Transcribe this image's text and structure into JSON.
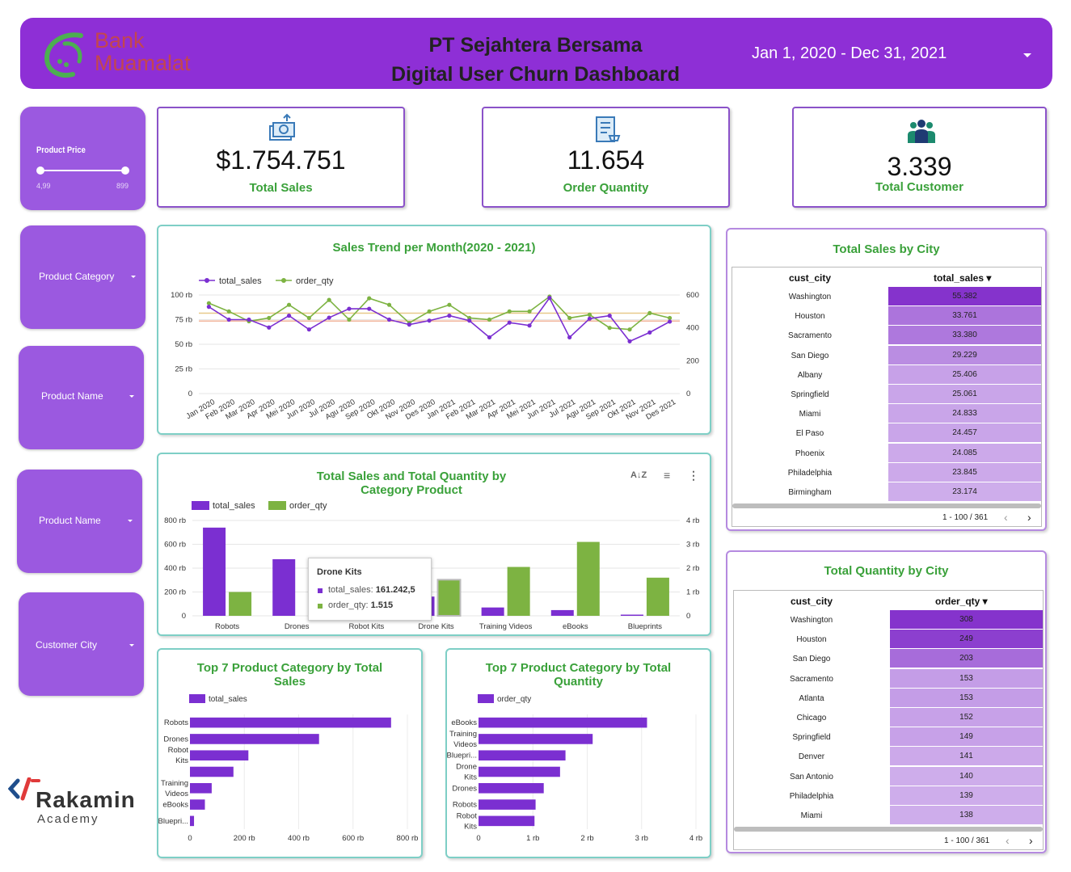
{
  "header": {
    "logo_line1": "Bank",
    "logo_line2": "Muamalat",
    "title_line1": "PT Sejahtera Bersama",
    "title_line2": "Digital User Churn Dashboard",
    "date_range": "Jan 1, 2020 - Dec 31, 2021"
  },
  "filters": {
    "price": {
      "label": "Product Price",
      "min": "4,99",
      "max": "899"
    },
    "category": "Product Category",
    "name1": "Product Name",
    "name2": "Product Name",
    "city": "Customer City"
  },
  "kpis": [
    {
      "value": "$1.754.751",
      "label": "Total Sales",
      "icon": "money-transfer-icon"
    },
    {
      "value": "11.654",
      "label": "Order Quantity",
      "icon": "order-list-icon"
    },
    {
      "value": "3.339",
      "label": "Total Customer",
      "icon": "customers-group-icon"
    }
  ],
  "brand": {
    "name": "Rakamin",
    "sub": "Academy"
  },
  "colors": {
    "purple": "#7b2fd1",
    "green": "#7db342",
    "header": "#8e2fd6",
    "filter": "#9b59e0",
    "kpi_text": "#3aa13a"
  },
  "chart_data": [
    {
      "type": "line",
      "title": "Sales Trend per Month(2020 - 2021)",
      "categories": [
        "Jan 2020",
        "Feb 2020",
        "Mar 2020",
        "Apr 2020",
        "Mei 2020",
        "Jun 2020",
        "Jul 2020",
        "Agu 2020",
        "Sep 2020",
        "Okt 2020",
        "Nov 2020",
        "Des 2020",
        "Jan 2021",
        "Feb 2021",
        "Mar 2021",
        "Apr 2021",
        "Mei 2021",
        "Jun 2021",
        "Jul 2021",
        "Agu 2021",
        "Sep 2021",
        "Okt 2021",
        "Nov 2021",
        "Des 2021"
      ],
      "yticks_left": [
        "0",
        "25 rb",
        "50 rb",
        "75 rb",
        "100 rb"
      ],
      "yticks_right": [
        "0",
        "200",
        "400",
        "600"
      ],
      "ylim_left": [
        0,
        100000
      ],
      "ylim_right": [
        0,
        600
      ],
      "series": [
        {
          "name": "total_sales",
          "axis": "left",
          "color": "#7b2fd1",
          "values": [
            88000,
            75000,
            75000,
            67000,
            79000,
            65000,
            77000,
            86000,
            86000,
            75000,
            70000,
            74000,
            79000,
            74000,
            57000,
            72000,
            69000,
            97000,
            57000,
            76000,
            79000,
            53000,
            62000,
            73000
          ]
        },
        {
          "name": "order_qty",
          "axis": "right",
          "color": "#7db342",
          "values": [
            550,
            500,
            440,
            460,
            540,
            460,
            570,
            450,
            580,
            540,
            430,
            500,
            540,
            460,
            450,
            500,
            500,
            590,
            460,
            480,
            400,
            390,
            490,
            460
          ]
        }
      ]
    },
    {
      "type": "bar",
      "title": "Total Sales and Total Quantity by Category Product",
      "categories": [
        "Robots",
        "Drones",
        "Robot Kits",
        "Drone Kits",
        "Training Videos",
        "eBooks",
        "Blueprints"
      ],
      "yticks_left": [
        "0",
        "200 rb",
        "400 rb",
        "600 rb",
        "800 rb"
      ],
      "yticks_right": [
        "0",
        "1 rb",
        "2 rb",
        "3 rb",
        "4 rb"
      ],
      "ylim_left": [
        0,
        800000
      ],
      "ylim_right": [
        0,
        4000
      ],
      "series": [
        {
          "name": "total_sales",
          "axis": "left",
          "color": "#7b2fd1",
          "values": [
            740000,
            475000,
            300000,
            161242.5,
            70000,
            48000,
            10000
          ]
        },
        {
          "name": "order_qty",
          "axis": "right",
          "color": "#7db342",
          "values": [
            1000,
            0,
            0,
            1515,
            2050,
            3100,
            1600
          ]
        }
      ],
      "tooltip": {
        "title": "Drone Kits",
        "line1_label": "total_sales:",
        "line1_value": "161.242,5",
        "line2_label": "order_qty:",
        "line2_value": "1.515"
      }
    },
    {
      "type": "bar",
      "orientation": "horizontal",
      "title_line1": "Top 7 Product Category by Total",
      "title_line2": "Sales",
      "series_name": "total_sales",
      "categories": [
        [
          "Robots"
        ],
        [
          "Drones"
        ],
        [
          "Robot",
          "Kits"
        ],
        [
          ""
        ],
        [
          "Training",
          "Videos"
        ],
        [
          "eBooks"
        ],
        [
          "Bluepri..."
        ]
      ],
      "values": [
        740000,
        475000,
        215000,
        160000,
        80000,
        55000,
        15000
      ],
      "xticks": [
        "0",
        "200 rb",
        "400 rb",
        "600 rb",
        "800 rb"
      ],
      "xlim": [
        0,
        800000
      ]
    },
    {
      "type": "bar",
      "orientation": "horizontal",
      "title_line1": "Top 7 Product Category by Total",
      "title_line2": "Quantity",
      "series_name": "order_qty",
      "categories": [
        [
          "eBooks"
        ],
        [
          "Training",
          "Videos"
        ],
        [
          "Bluepri..."
        ],
        [
          "Drone",
          "Kits"
        ],
        [
          "Drones"
        ],
        [
          "Robots"
        ],
        [
          "Robot",
          "Kits"
        ]
      ],
      "values": [
        3100,
        2100,
        1600,
        1500,
        1200,
        1050,
        1030
      ],
      "xticks": [
        "0",
        "1 rb",
        "2 rb",
        "3 rb",
        "4 rb"
      ],
      "xlim": [
        0,
        4000
      ]
    },
    {
      "type": "table",
      "title": "Total Sales by City",
      "columns": [
        "cust_city",
        "total_sales"
      ],
      "rows": [
        [
          "Washington",
          "55.382"
        ],
        [
          "Houston",
          "33.761"
        ],
        [
          "Sacramento",
          "33.380"
        ],
        [
          "San Diego",
          "29.229"
        ],
        [
          "Albany",
          "25.406"
        ],
        [
          "Springfield",
          "25.061"
        ],
        [
          "Miami",
          "24.833"
        ],
        [
          "El Paso",
          "24.457"
        ],
        [
          "Phoenix",
          "24.085"
        ],
        [
          "Philadelphia",
          "23.845"
        ],
        [
          "Birmingham",
          "23.174"
        ]
      ],
      "pagination": "1 - 100 / 361"
    },
    {
      "type": "table",
      "title": "Total Quantity by City",
      "columns": [
        "cust_city",
        "order_qty"
      ],
      "rows": [
        [
          "Washington",
          "308"
        ],
        [
          "Houston",
          "249"
        ],
        [
          "San Diego",
          "203"
        ],
        [
          "Sacramento",
          "153"
        ],
        [
          "Atlanta",
          "153"
        ],
        [
          "Chicago",
          "152"
        ],
        [
          "Springfield",
          "149"
        ],
        [
          "Denver",
          "141"
        ],
        [
          "San Antonio",
          "140"
        ],
        [
          "Philadelphia",
          "139"
        ],
        [
          "Miami",
          "138"
        ]
      ],
      "pagination": "1 - 100 / 361"
    }
  ]
}
